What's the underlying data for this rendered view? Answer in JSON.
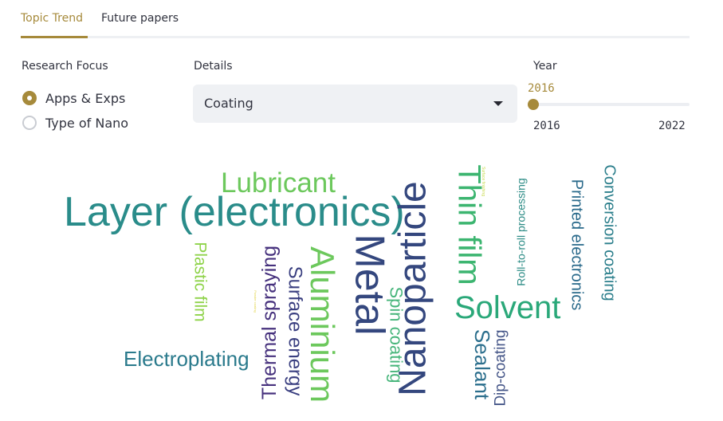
{
  "tabs": [
    {
      "label": "Topic Trend",
      "active": true
    },
    {
      "label": "Future papers",
      "active": false
    }
  ],
  "accent_color": "#a68a3b",
  "research_focus": {
    "label": "Research Focus",
    "options": [
      {
        "label": "Apps & Exps",
        "selected": true
      },
      {
        "label": "Type of Nano",
        "selected": false
      }
    ]
  },
  "details": {
    "label": "Details",
    "selected": "Coating"
  },
  "year": {
    "label": "Year",
    "value": "2016",
    "min": "2016",
    "max": "2022"
  },
  "word_cloud": {
    "words": [
      {
        "text": "Layer (electronics)",
        "color": "#2a8c8a"
      },
      {
        "text": "Lubricant",
        "color": "#6cc85c"
      },
      {
        "text": "Metal",
        "color": "#34477e"
      },
      {
        "text": "Nanoparticle",
        "color": "#34477e"
      },
      {
        "text": "Thin film",
        "color": "#3cb570"
      },
      {
        "text": "Aluminium",
        "color": "#6cc85c"
      },
      {
        "text": "Solvent",
        "color": "#2aa879"
      },
      {
        "text": "Plastic film",
        "color": "#8fd34a"
      },
      {
        "text": "Thermal spraying",
        "color": "#46317d"
      },
      {
        "text": "Surface energy",
        "color": "#3a3f80"
      },
      {
        "text": "Spin coating",
        "color": "#46b57a"
      },
      {
        "text": "Sealant",
        "color": "#2c6f8d"
      },
      {
        "text": "Dip-coating",
        "color": "#455688"
      },
      {
        "text": "Roll-to-roll processing",
        "color": "#2d8c86"
      },
      {
        "text": "Printed electronics",
        "color": "#2a6a8b"
      },
      {
        "text": "Conversion coating",
        "color": "#2c7f8c"
      },
      {
        "text": "Electroplating",
        "color": "#2a7a8c"
      },
      {
        "text": "Surface finishing",
        "color": "#c7d94a"
      },
      {
        "text": "Powder coating",
        "color": "#e2d44a"
      }
    ]
  }
}
